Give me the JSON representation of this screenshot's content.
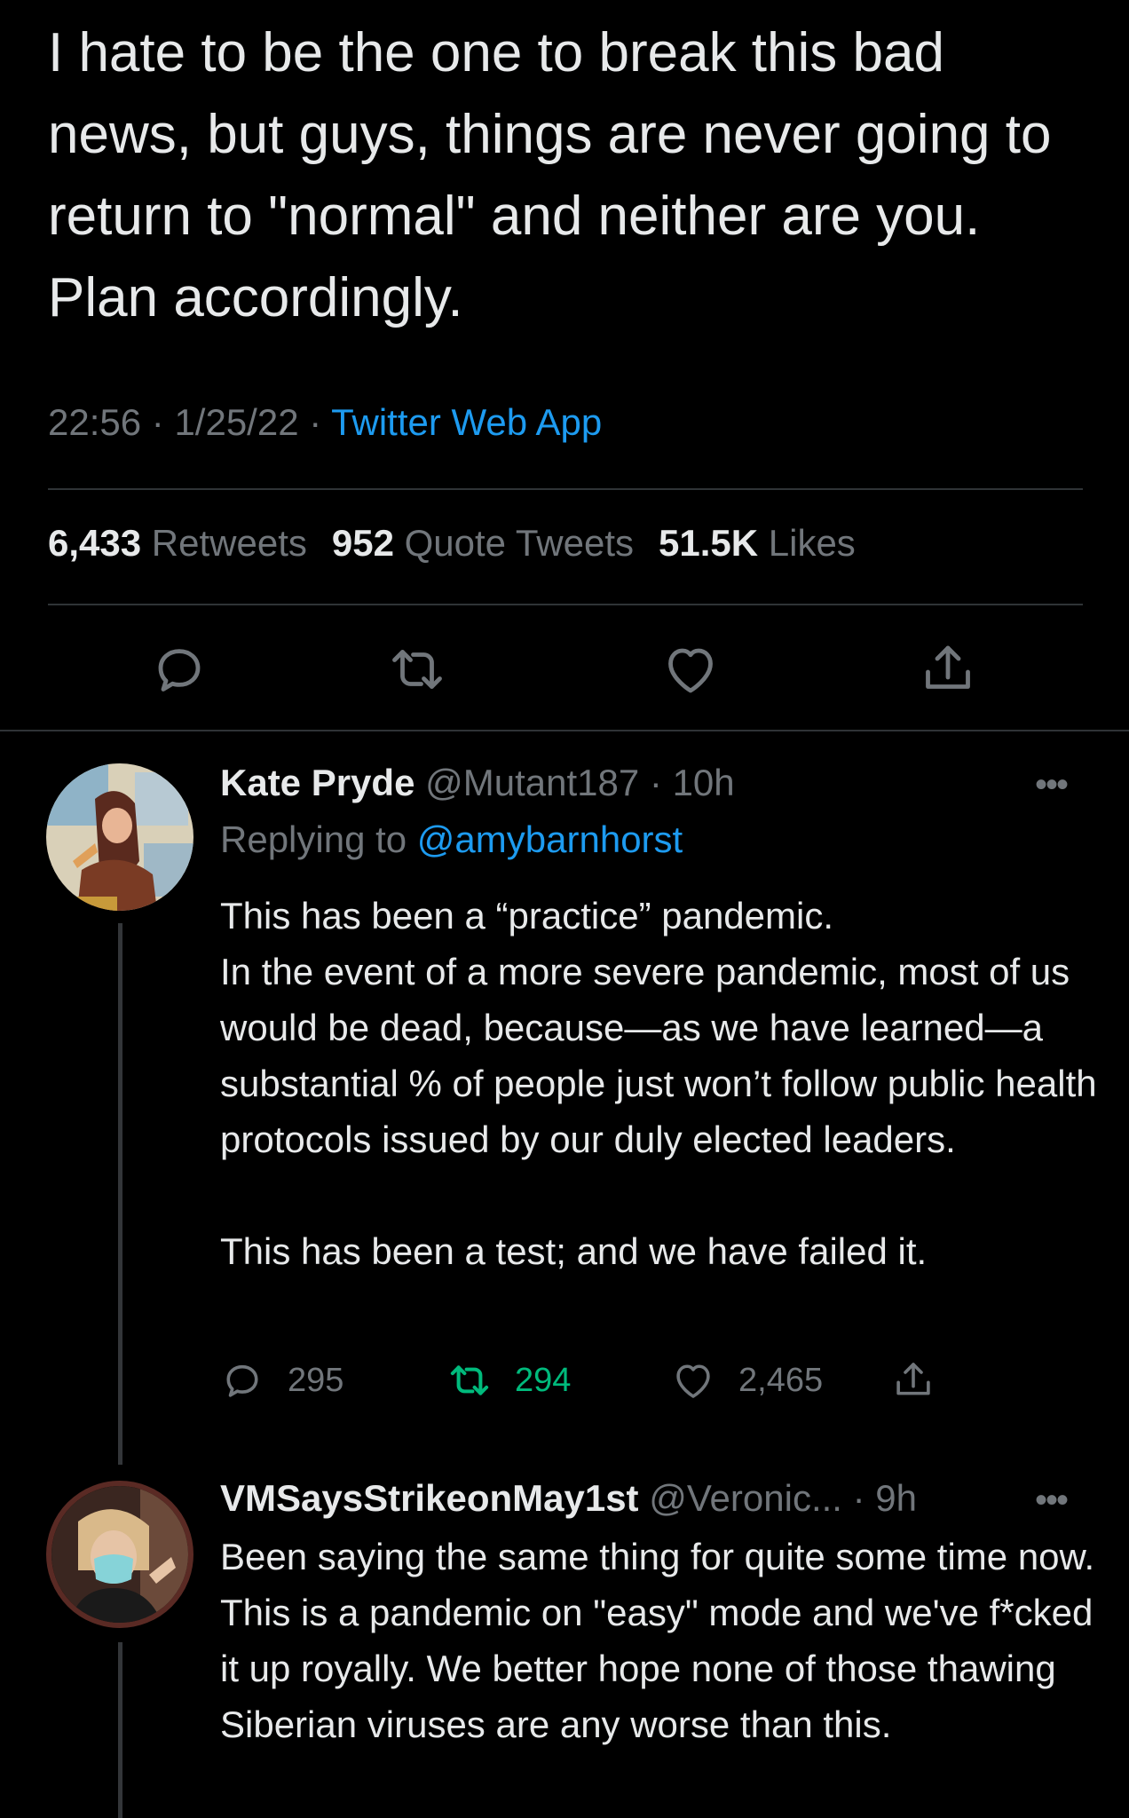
{
  "tweet": {
    "text": "I hate to be the one to break this bad news, but guys, things are never going to return to \"normal\" and neither are you. Plan accordingly.",
    "time": "22:56",
    "date": "1/25/22",
    "source": "Twitter Web App",
    "retweets_count": "6,433",
    "retweets_label": "Retweets",
    "quotes_count": "952",
    "quotes_label": "Quote Tweets",
    "likes_count": "51.5K",
    "likes_label": "Likes"
  },
  "replies": [
    {
      "name": "Kate Pryde",
      "handle": "@Mutant187",
      "time": "10h",
      "replying_prefix": "Replying to",
      "replying_to": "@amybarnhorst",
      "body": "This has been a “practice” pandemic.\nIn the event of a more severe pandemic, most of us would be dead, because—as we have learned—a substantial % of people just won’t follow public health protocols issued by our duly elected leaders.\n\nThis has been a test; and we have failed it.",
      "reply_count": "295",
      "retweet_count": "294",
      "like_count": "2,465"
    },
    {
      "name": "VMSaysStrikeonMay1st",
      "handle": "@Veronic...",
      "time": "9h",
      "body": "Been saying the same thing for quite some time now. This is a pandemic on \"easy\" mode and we've f*cked it up royally. We better hope none of those thawing Siberian viruses are any worse than this."
    }
  ],
  "icons": {
    "reply": "reply-bubble-icon",
    "retweet": "retweet-icon",
    "like": "heart-icon",
    "share": "share-icon",
    "more": "more-dots-icon"
  },
  "colors": {
    "background": "#000000",
    "text": "#e7e9ea",
    "muted": "#71767b",
    "link": "#1d9bf0",
    "retweet_active": "#00ba7c",
    "divider": "#2f3336"
  }
}
